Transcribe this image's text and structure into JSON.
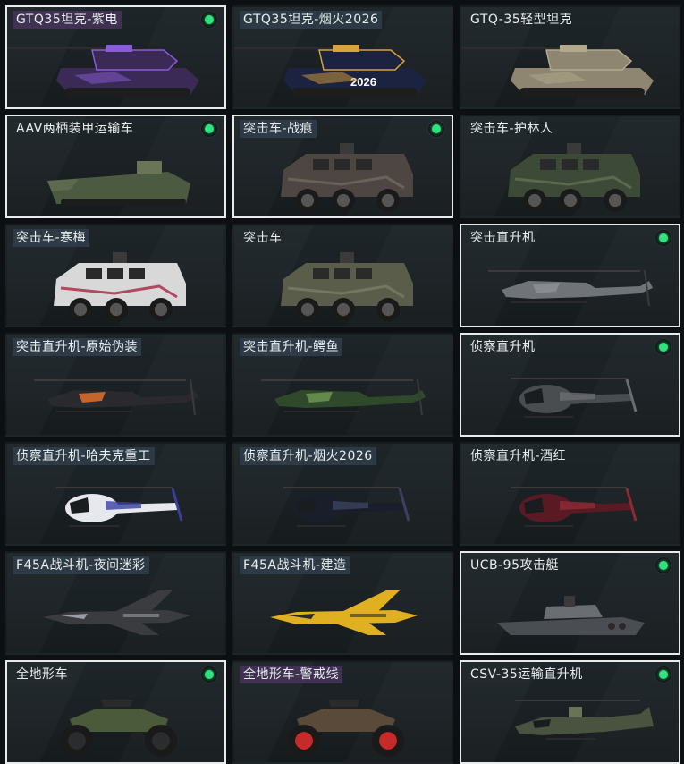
{
  "accent_color": "#2ee37d",
  "vehicles": [
    {
      "name": "GTQ35坦克-紫电",
      "owned": true,
      "label_style": "purple",
      "icon": "tank-icon",
      "body_color": "#3a2a55",
      "accent": "#8a5cd6"
    },
    {
      "name": "GTQ35坦克-烟火2026",
      "owned": false,
      "label_style": "hl",
      "icon": "tank-icon",
      "body_color": "#1c2340",
      "accent": "#d9a23a",
      "decal": "2026"
    },
    {
      "name": "GTQ-35轻型坦克",
      "owned": false,
      "label_style": "",
      "icon": "tank-icon",
      "body_color": "#8e8670",
      "accent": "#b2a98c"
    },
    {
      "name": "AAV两栖装甲运输车",
      "owned": true,
      "label_style": "",
      "icon": "amphibious-vehicle-icon",
      "body_color": "#4d5a42",
      "accent": "#6a7558"
    },
    {
      "name": "突击车-战痕",
      "owned": true,
      "label_style": "hl",
      "icon": "armored-car-icon",
      "body_color": "#4e4642",
      "accent": "#6b615b"
    },
    {
      "name": "突击车-护林人",
      "owned": false,
      "label_style": "",
      "icon": "armored-car-icon",
      "body_color": "#3e4a38",
      "accent": "#5a6a50"
    },
    {
      "name": "突击车-寒梅",
      "owned": false,
      "label_style": "hl",
      "icon": "armored-car-icon",
      "body_color": "#d8d8d8",
      "accent": "#b04860"
    },
    {
      "name": "突击车",
      "owned": false,
      "label_style": "",
      "icon": "armored-car-icon",
      "body_color": "#5a5d4a",
      "accent": "#74775f"
    },
    {
      "name": "突击直升机",
      "owned": true,
      "label_style": "",
      "icon": "attack-helicopter-icon",
      "body_color": "#707478",
      "accent": "#8c9094"
    },
    {
      "name": "突击直升机-原始伪装",
      "owned": false,
      "label_style": "hl",
      "icon": "attack-helicopter-icon",
      "body_color": "#2a2a2e",
      "accent": "#e0702a"
    },
    {
      "name": "突击直升机-鳄鱼",
      "owned": false,
      "label_style": "hl",
      "icon": "attack-helicopter-icon",
      "body_color": "#2f4a2a",
      "accent": "#6e9450"
    },
    {
      "name": "侦察直升机",
      "owned": true,
      "label_style": "",
      "icon": "scout-helicopter-icon",
      "body_color": "#4a4d50",
      "accent": "#6a6d70"
    },
    {
      "name": "侦察直升机-哈夫克重工",
      "owned": false,
      "label_style": "hl",
      "icon": "scout-helicopter-icon",
      "body_color": "#e6e8ee",
      "accent": "#3a3e9c"
    },
    {
      "name": "侦察直升机-烟火2026",
      "owned": false,
      "label_style": "hl",
      "icon": "scout-helicopter-icon",
      "body_color": "#1a1e2a",
      "accent": "#3a4260"
    },
    {
      "name": "侦察直升机-酒红",
      "owned": false,
      "label_style": "",
      "icon": "scout-helicopter-icon",
      "body_color": "#5a1a24",
      "accent": "#8e2a36"
    },
    {
      "name": "F45A战斗机-夜间迷彩",
      "owned": false,
      "label_style": "hl",
      "icon": "fighter-jet-icon",
      "body_color": "#3a3c40",
      "accent": "#9a9ea4"
    },
    {
      "name": "F45A战斗机-建造",
      "owned": false,
      "label_style": "hl",
      "icon": "fighter-jet-icon",
      "body_color": "#e0b020",
      "accent": "#2a2a2a"
    },
    {
      "name": "UCB-95攻击艇",
      "owned": true,
      "label_style": "",
      "icon": "attack-boat-icon",
      "body_color": "#4a4e52",
      "accent": "#6a6e72"
    },
    {
      "name": "全地形车",
      "owned": true,
      "label_style": "",
      "icon": "atv-icon",
      "body_color": "#4a5a3a",
      "accent": "#2a2c2e"
    },
    {
      "name": "全地形车-警戒线",
      "owned": false,
      "label_style": "purple",
      "icon": "atv-icon",
      "body_color": "#5a4a3a",
      "accent": "#c82a2a"
    },
    {
      "name": "CSV-35运输直升机",
      "owned": true,
      "label_style": "",
      "icon": "transport-helicopter-icon",
      "body_color": "#4a5240",
      "accent": "#6a7258"
    }
  ]
}
